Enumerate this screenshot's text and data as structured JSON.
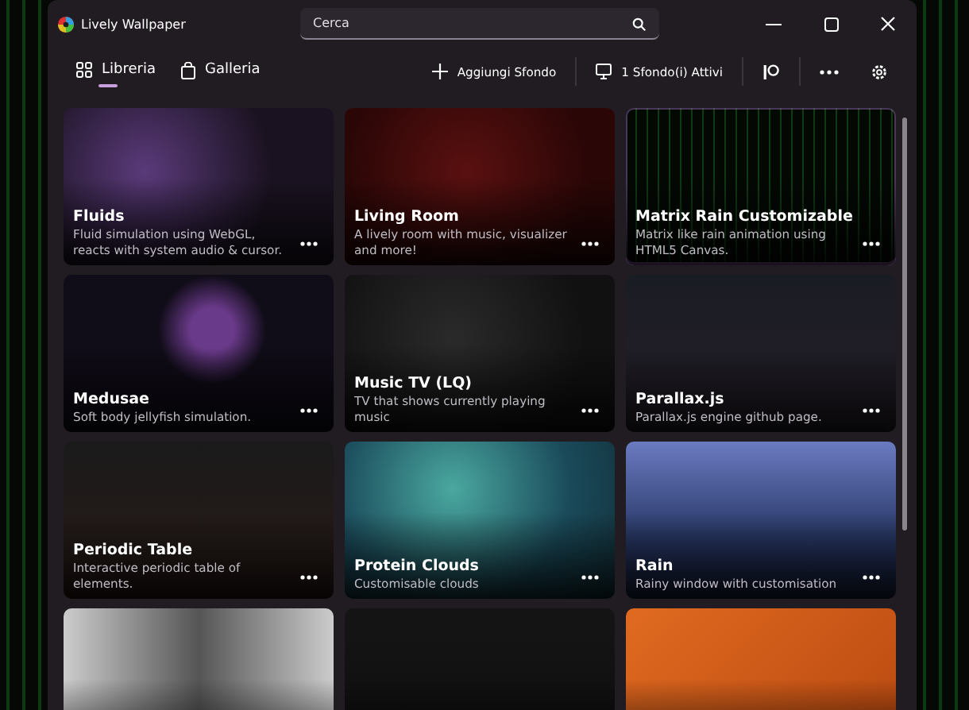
{
  "window": {
    "title": "Lively Wallpaper"
  },
  "search": {
    "placeholder": "Cerca"
  },
  "tabs": [
    {
      "label": "Libreria",
      "selected": true
    },
    {
      "label": "Galleria",
      "selected": false
    }
  ],
  "toolbar": {
    "add_label": "Aggiungi Sfondo",
    "active_label": "1 Sfondo(i) Attivi"
  },
  "wallpapers": [
    {
      "title": "Fluids",
      "description": "Fluid simulation using WebGL, reacts with system audio & cursor.",
      "selected": false
    },
    {
      "title": "Living Room",
      "description": "A lively room with music, visualizer and more!",
      "selected": false
    },
    {
      "title": "Matrix Rain Customizable",
      "description": "Matrix like rain animation using HTML5 Canvas.",
      "selected": true
    },
    {
      "title": "Medusae",
      "description": "Soft body jellyfish simulation.",
      "selected": false
    },
    {
      "title": "Music TV (LQ)",
      "description": "TV that shows currently playing music",
      "selected": false
    },
    {
      "title": "Parallax.js",
      "description": "Parallax.js engine github page.",
      "selected": false
    },
    {
      "title": "Periodic Table",
      "description": "Interactive periodic table of elements.",
      "selected": false
    },
    {
      "title": "Protein Clouds",
      "description": "Customisable clouds",
      "selected": false
    },
    {
      "title": "Rain",
      "description": "Rainy window with customisation",
      "selected": false
    },
    {
      "selected": false
    },
    {
      "selected": false
    },
    {
      "selected": false
    }
  ]
}
